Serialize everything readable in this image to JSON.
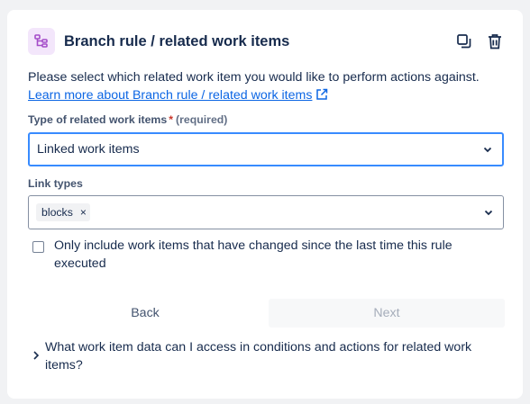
{
  "header": {
    "title": "Branch rule / related work items",
    "icon": "branch-rule-icon",
    "actions": [
      "copy-icon",
      "trash-icon"
    ],
    "accent": "#a54dc9"
  },
  "description": {
    "text": "Please select which related work item you would like to perform actions against.",
    "link_text": "Learn more about Branch rule / related work items"
  },
  "type_field": {
    "label": "Type of related work items",
    "required_mark": "*",
    "required_text": "(required)",
    "value": "Linked work items"
  },
  "link_types": {
    "label": "Link types",
    "tags": [
      "blocks"
    ],
    "remove_glyph": "×"
  },
  "checkbox": {
    "label": "Only include work items that have changed since the last time this rule executed",
    "checked": false
  },
  "buttons": {
    "back": "Back",
    "next": "Next"
  },
  "expander": {
    "text": "What work item data can I access in conditions and actions for related work items?"
  },
  "colors": {
    "focus": "#388bff",
    "link": "#0c66e4",
    "required": "#c9372c"
  }
}
